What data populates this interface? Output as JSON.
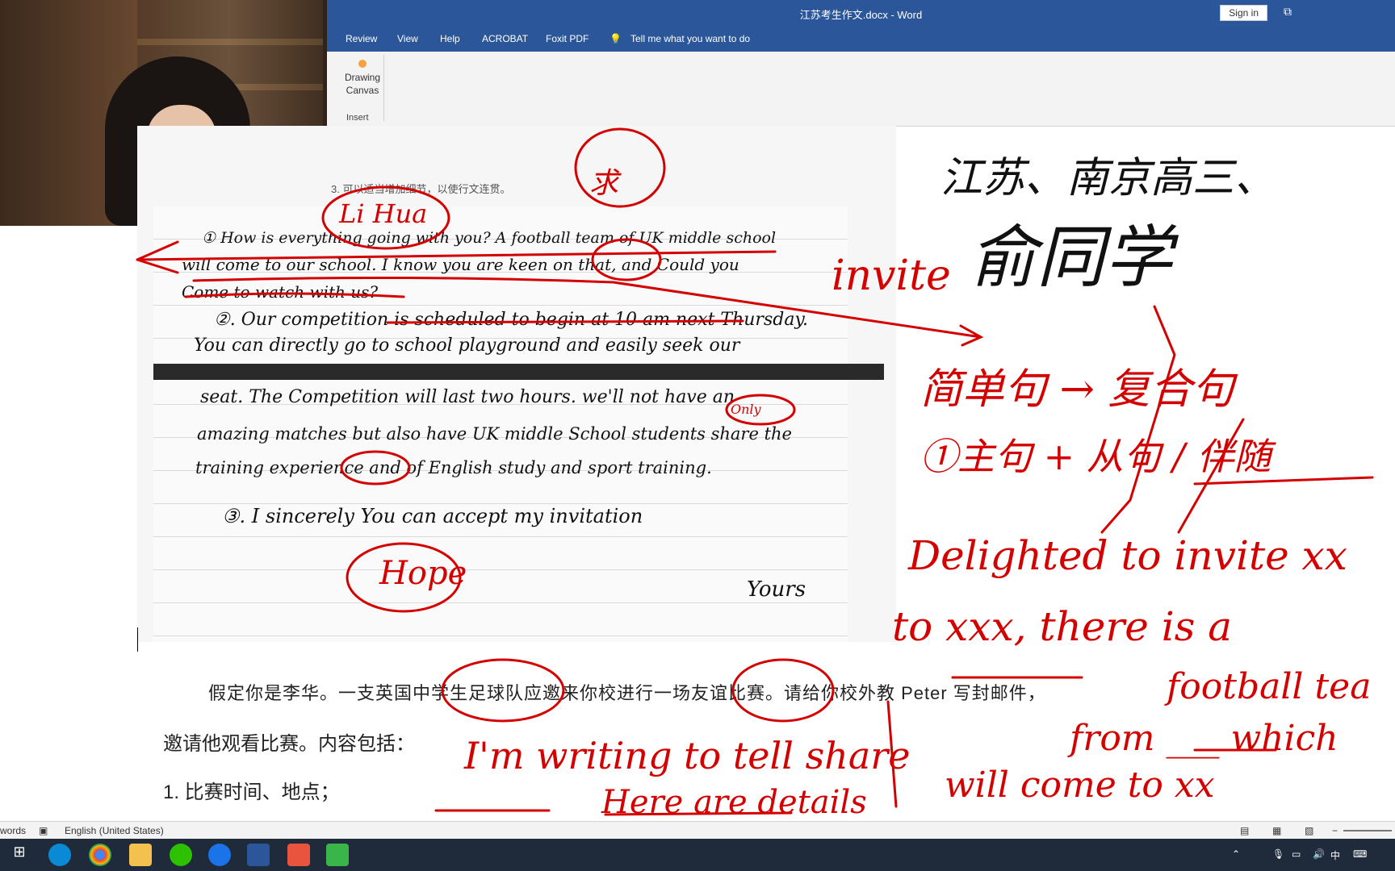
{
  "window": {
    "title": "江苏考生作文.docx  -  Word",
    "signin": "Sign in"
  },
  "ribbon": {
    "tabs": [
      "Review",
      "View",
      "Help",
      "ACROBAT",
      "Foxit PDF",
      "Tell me what you want to do"
    ],
    "drawing_canvas": "Drawing\nCanvas",
    "group": "Insert"
  },
  "doc_image": {
    "note": "3. 可以适当增加细节，以使行文连贯。",
    "lines": [
      "① How is everything going with you? A football team of UK middle school",
      "will come to our school. I know you are keen on that, and Could you",
      "Come to watch with us?",
      "②. Our competition is scheduled to begin at 10 am next Thursday.",
      "You can directly go to school playground and easily seek our",
      "seat. The Competition will last two hours. we'll not have an",
      "amazing matches but also have UK middle School students share the",
      "training experience and of English study and sport training.",
      "③. I sincerely You can accept my invitation",
      "Yours"
    ]
  },
  "prompt": {
    "line1": "假定你是李华。一支英国中学生足球队应邀来你校进行一场友谊比赛。请给你校外教   Peter   写封邮件，",
    "line2": "邀请他观看比赛。内容包括：",
    "line3": "1. 比赛时间、地点；"
  },
  "annotations": {
    "black": [
      "江苏、南京高三、",
      "俞同学"
    ],
    "red": [
      "invite",
      "简单句 → 复合句",
      "①主句 + 从句 / 伴随",
      "Delighted to invite xx",
      "to xxx, there is a",
      "football tea",
      "from ___ which",
      "will come to xx",
      "I'm writing to tell share",
      "Here are details",
      "Li Hua",
      "Hope",
      "求",
      "Only"
    ]
  },
  "statusbar": {
    "words": "words",
    "language": "English (United States)"
  },
  "taskbar": {
    "ime": "中"
  }
}
